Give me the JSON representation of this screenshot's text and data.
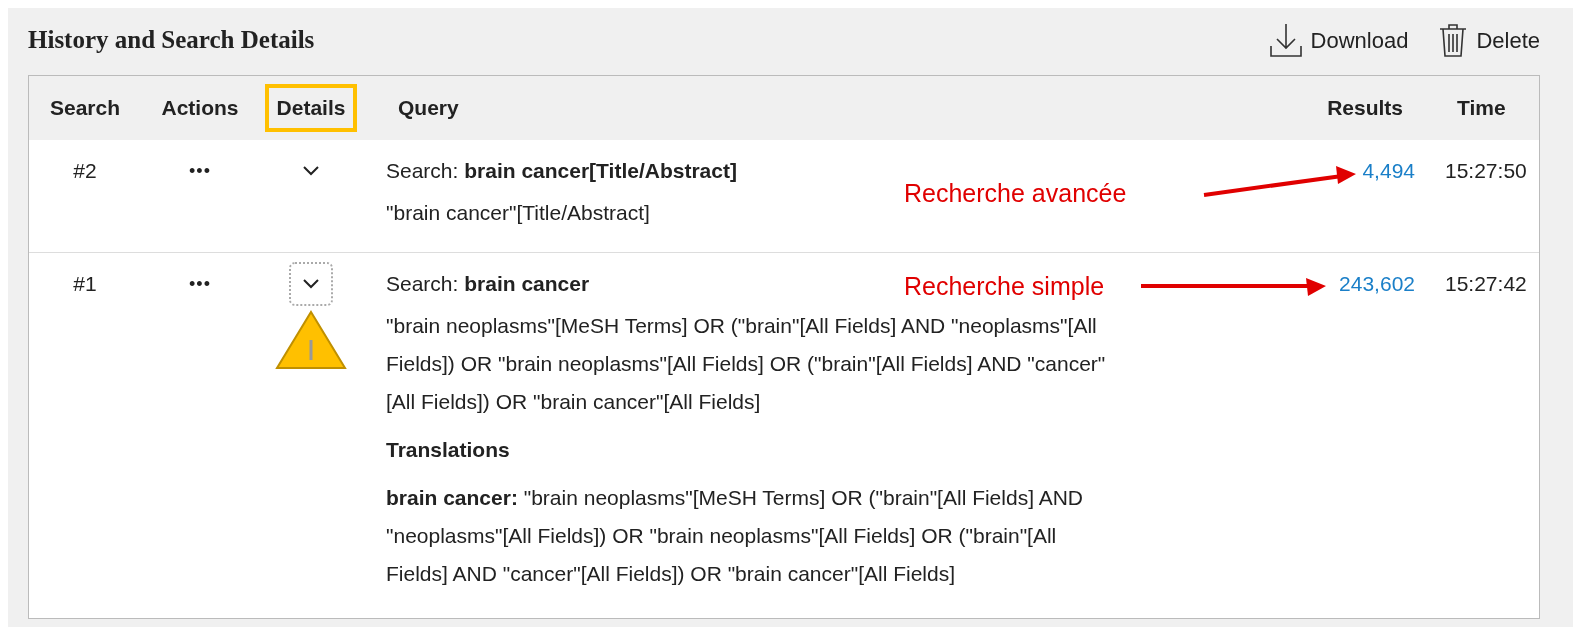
{
  "title": "History and Search Details",
  "toolbar": [
    {
      "label": "Download",
      "kind": "download"
    },
    {
      "label": "Delete",
      "kind": "delete"
    }
  ],
  "columns": [
    {
      "label": "Search",
      "highlighted": false
    },
    {
      "label": "Actions",
      "highlighted": false
    },
    {
      "label": "Details",
      "highlighted": true
    },
    {
      "label": "Query",
      "highlighted": false
    },
    {
      "label": "Results",
      "highlighted": false
    },
    {
      "label": "Time",
      "highlighted": false
    }
  ],
  "rows": [
    {
      "number": "#2",
      "actions": "•••",
      "details_focused": false,
      "warning": false,
      "search_label": "Search:",
      "search_term": "brain cancer[Title/Abstract]",
      "query": "\"brain cancer\"[Title/Abstract]",
      "results": "4,494",
      "time": "15:27:50",
      "annotation": "Recherche avancée"
    },
    {
      "number": "#1",
      "actions": "•••",
      "details_focused": true,
      "warning": true,
      "search_label": "Search:",
      "search_term": "brain cancer",
      "query": "\"brain neoplasms\"[MeSH Terms] OR (\"brain\"[All Fields] AND \"neoplasms\"[All Fields]) OR \"brain neoplasms\"[All Fields] OR (\"brain\"[All Fields] AND \"cancer\"[All Fields]) OR \"brain cancer\"[All Fields]",
      "translations_heading": "Translations",
      "translation": "**brain cancer:** \"brain neoplasms\"[MeSH Terms] OR (\"brain\"[All Fields] AND \"neoplasms\"[All Fields]) OR \"brain neoplasms\"[All Fields] OR (\"brain\"[All Fields] AND \"cancer\"[All Fields]) OR \"brain cancer\"[All Fields]",
      "results": "243,602",
      "time": "15:27:42",
      "annotation": "Recherche simple"
    }
  ]
}
